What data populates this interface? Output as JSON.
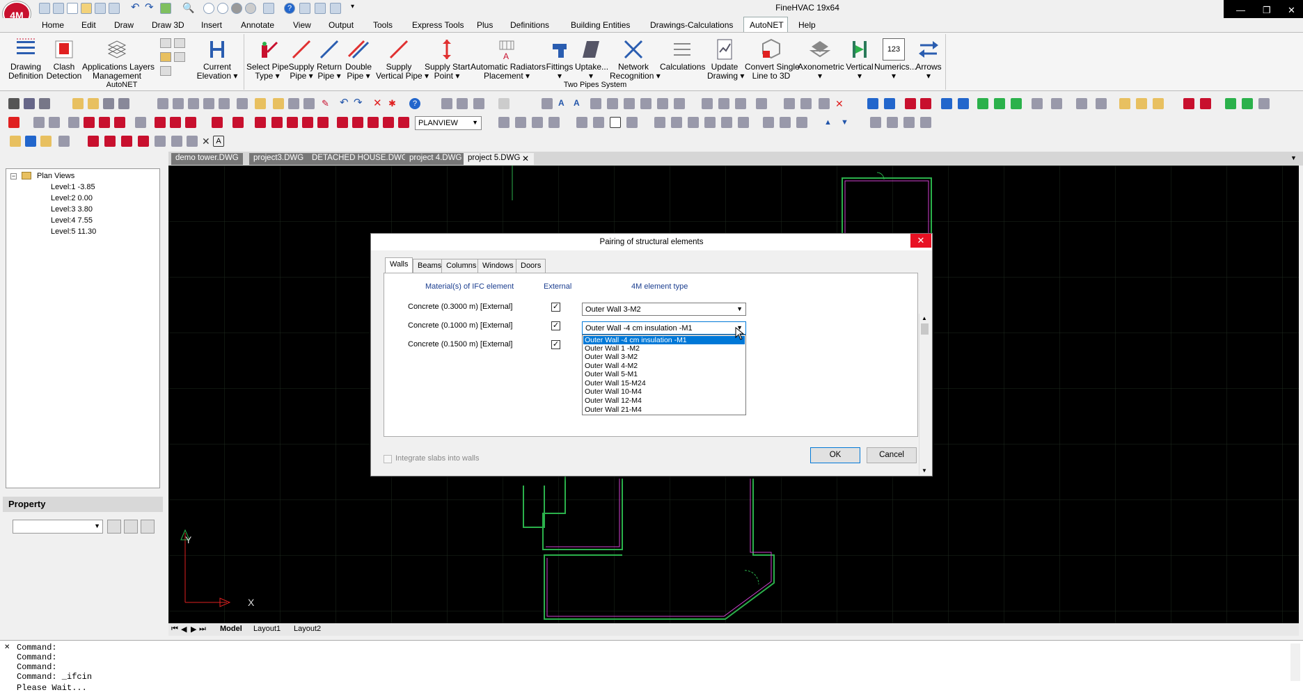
{
  "app": {
    "title": "FineHVAC 19x64",
    "logo": "4M",
    "accent": "#c8102e"
  },
  "window_controls": {
    "minimize": "—",
    "restore": "❐",
    "close": "✕"
  },
  "menu": {
    "items": [
      "Home",
      "Edit",
      "Draw",
      "Draw 3D",
      "Insert",
      "Annotate",
      "View",
      "Output",
      "Tools",
      "Express Tools",
      "Plus",
      "Definitions",
      "Building Entities",
      "Drawings-Calculations",
      "AutoNET",
      "Help"
    ],
    "active": "AutoNET"
  },
  "ribbon": {
    "buttons": [
      {
        "label": "Drawing\nDefinition",
        "icon": "drawing-definition-icon"
      },
      {
        "label": "Clash\nDetection",
        "icon": "clash-detection-icon"
      },
      {
        "label": "Applications Layers\nManagement",
        "icon": "layers-icon"
      },
      {
        "label": "Current\nElevation ▾",
        "icon": "elevation-icon"
      },
      {
        "label": "Select Pipe\nType ▾",
        "icon": "pipe-type-icon"
      },
      {
        "label": "Supply\nPipe ▾",
        "icon": "supply-pipe-icon"
      },
      {
        "label": "Return\nPipe ▾",
        "icon": "return-pipe-icon"
      },
      {
        "label": "Double\nPipe ▾",
        "icon": "double-pipe-icon"
      },
      {
        "label": "Supply\nVertical Pipe ▾",
        "icon": "vertical-pipe-icon"
      },
      {
        "label": "Supply Start\nPoint ▾",
        "icon": "start-point-icon"
      },
      {
        "label": "Automatic Radiators\nPlacement ▾",
        "icon": "radiator-icon"
      },
      {
        "label": "Fittings\n▾",
        "icon": "fittings-icon"
      },
      {
        "label": "Uptake...\n▾",
        "icon": "uptake-icon"
      },
      {
        "label": "Network\nRecognition ▾",
        "icon": "network-icon"
      },
      {
        "label": "Calculations",
        "icon": "calculations-icon"
      },
      {
        "label": "Update\nDrawing ▾",
        "icon": "update-drawing-icon"
      },
      {
        "label": "Convert Single\nLine to 3D",
        "icon": "convert-3d-icon"
      },
      {
        "label": "Axonometric\n▾",
        "icon": "axonometric-icon"
      },
      {
        "label": "Vertical\n▾",
        "icon": "vertical-icon"
      },
      {
        "label": "Numerics...\n▾",
        "icon": "numerics-icon"
      },
      {
        "label": "Arrows\n▾",
        "icon": "arrows-icon"
      }
    ],
    "groups": [
      "AutoNET",
      "Two Pipes System"
    ],
    "numerics_badge": "123"
  },
  "toolbar": {
    "view_select": "PLANVIEW"
  },
  "doc_tabs": [
    "demo tower.DWG",
    "project3.DWG",
    "DETACHED HOUSE.DWG",
    "project 4.DWG",
    "project 5.DWG"
  ],
  "doc_tab_active": "project 5.DWG",
  "tree": {
    "root": "Plan Views",
    "levels": [
      "Level:1  -3.85",
      "Level:2  0.00",
      "Level:3  3.80",
      "Level:4  7.55",
      "Level:5  11.30"
    ]
  },
  "property": {
    "title": "Property"
  },
  "layout_tabs": [
    "Model",
    "Layout1",
    "Layout2"
  ],
  "axes": {
    "y": "Y",
    "x": "X"
  },
  "command": {
    "lines": [
      "Command:",
      "Command:",
      "Command:",
      "Command:  _ifcin",
      "Please Wait..."
    ]
  },
  "dialog": {
    "title": "Pairing of structural elements",
    "tabs": [
      "Walls",
      "Beams",
      "Columns",
      "Windows",
      "Doors"
    ],
    "active_tab": "Walls",
    "headers": {
      "material": "Material(s) of IFC element",
      "external": "External",
      "type": "4M element type"
    },
    "rows": [
      {
        "material": "Concrete (0.3000 m) [External]",
        "external": true,
        "type": "Outer Wall 3-M2"
      },
      {
        "material": "Concrete (0.1000 m) [External]",
        "external": true,
        "type": "Outer Wall -4 cm insulation -M1"
      },
      {
        "material": "Concrete (0.1500 m) [External]",
        "external": true,
        "type": ""
      }
    ],
    "dropdown_options": [
      "Outer Wall -4 cm insulation -M1",
      "Outer Wall 1 -M2",
      "Outer Wall 3-M2",
      "Outer Wall 4-M2",
      "Outer Wall 5-M1",
      "Outer Wall 15-M24",
      "Outer Wall 10-M4",
      "Outer Wall 12-M4",
      "Outer Wall 21-M4"
    ],
    "dropdown_selected": "Outer Wall -4 cm insulation -M1",
    "integrate_slabs": "Integrate slabs into walls",
    "ok": "OK",
    "cancel": "Cancel"
  }
}
